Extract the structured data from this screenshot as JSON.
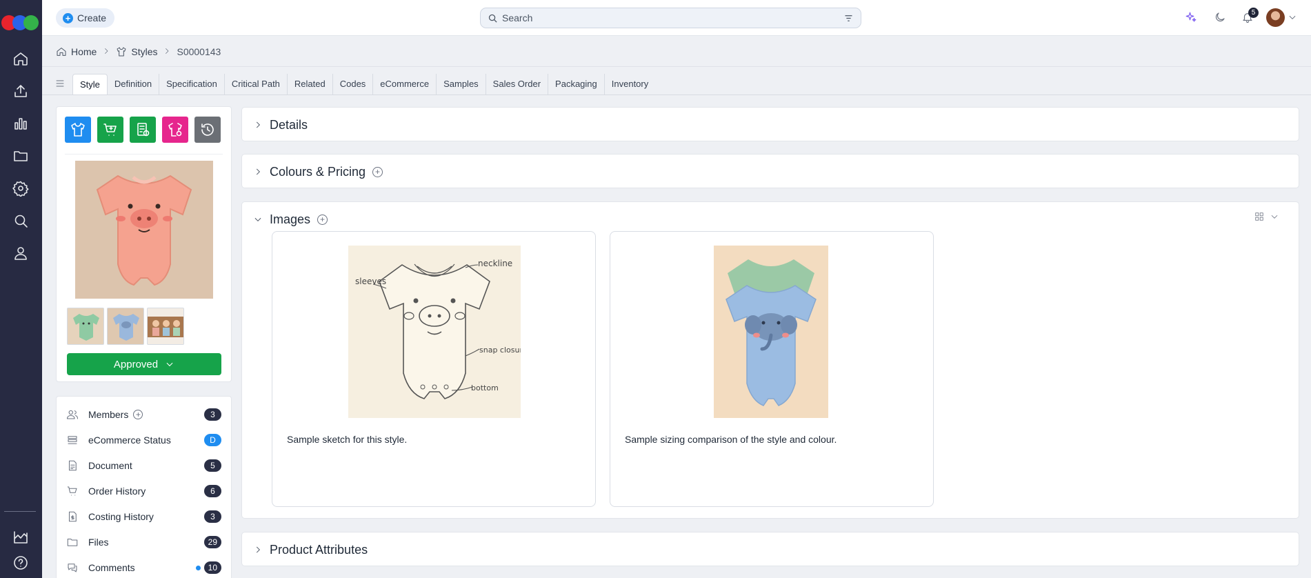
{
  "header": {
    "create_label": "Create",
    "search_placeholder": "Search",
    "notification_count": "5"
  },
  "breadcrumb": {
    "home": "Home",
    "styles": "Styles",
    "current": "S0000143"
  },
  "tabs": [
    "Style",
    "Definition",
    "Specification",
    "Critical Path",
    "Related",
    "Codes",
    "eCommerce",
    "Samples",
    "Sales Order",
    "Packaging",
    "Inventory"
  ],
  "left_panel": {
    "status_label": "Approved",
    "items": [
      {
        "label": "Members",
        "count": "3"
      },
      {
        "label": "eCommerce Status",
        "count": "D"
      },
      {
        "label": "Document",
        "count": "5"
      },
      {
        "label": "Order History",
        "count": "6"
      },
      {
        "label": "Costing History",
        "count": "3"
      },
      {
        "label": "Files",
        "count": "29"
      },
      {
        "label": "Comments",
        "count": "10"
      }
    ]
  },
  "sections": {
    "details": "Details",
    "colours_pricing": "Colours & Pricing",
    "images": "Images",
    "product_attributes": "Product Attributes"
  },
  "images": [
    {
      "caption": "Sample sketch for this style.",
      "annotations": [
        "neckline",
        "sleeves",
        "snap closure",
        "bottom"
      ]
    },
    {
      "caption": "Sample sizing comparison of the style and colour."
    }
  ],
  "colors": {
    "rail": "#272a42",
    "accent_blue": "#1f8df0",
    "approve_green": "#16a34a",
    "magenta": "#e6268d",
    "gray_btn": "#6b6f75"
  }
}
